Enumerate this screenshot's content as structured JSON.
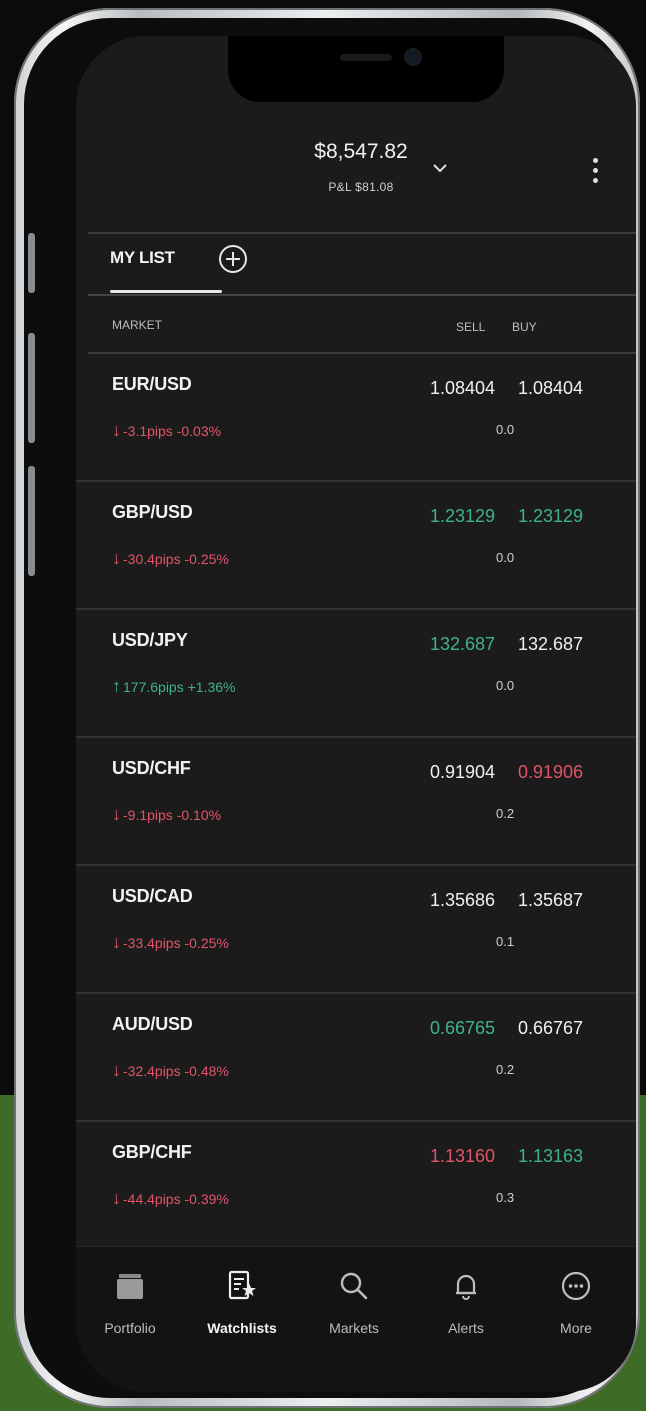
{
  "header": {
    "balance": "$8,547.82",
    "pnl": "P&L $81.08"
  },
  "tabs": {
    "active": "MY LIST"
  },
  "columns": {
    "market": "MARKET",
    "sell": "SELL",
    "buy": "BUY"
  },
  "rows": [
    {
      "pair": "EUR/USD",
      "direction": "down",
      "change": "-3.1pips -0.03%",
      "sell": "1.08404",
      "sell_color": "white",
      "buy": "1.08404",
      "buy_color": "white",
      "spread": "0.0"
    },
    {
      "pair": "GBP/USD",
      "direction": "down",
      "change": "-30.4pips -0.25%",
      "sell": "1.23129",
      "sell_color": "green",
      "buy": "1.23129",
      "buy_color": "green",
      "spread": "0.0"
    },
    {
      "pair": "USD/JPY",
      "direction": "up",
      "change": "177.6pips +1.36%",
      "sell": "132.687",
      "sell_color": "green",
      "buy": "132.687",
      "buy_color": "white",
      "spread": "0.0"
    },
    {
      "pair": "USD/CHF",
      "direction": "down",
      "change": "-9.1pips -0.10%",
      "sell": "0.91904",
      "sell_color": "white",
      "buy": "0.91906",
      "buy_color": "red",
      "spread": "0.2"
    },
    {
      "pair": "USD/CAD",
      "direction": "down",
      "change": "-33.4pips -0.25%",
      "sell": "1.35686",
      "sell_color": "white",
      "buy": "1.35687",
      "buy_color": "white",
      "spread": "0.1"
    },
    {
      "pair": "AUD/USD",
      "direction": "down",
      "change": "-32.4pips -0.48%",
      "sell": "0.66765",
      "sell_color": "green",
      "buy": "0.66767",
      "buy_color": "white",
      "spread": "0.2"
    },
    {
      "pair": "GBP/CHF",
      "direction": "down",
      "change": "-44.4pips -0.39%",
      "sell": "1.13160",
      "sell_color": "red",
      "buy": "1.13163",
      "buy_color": "green",
      "spread": "0.3"
    }
  ],
  "nav": [
    {
      "label": "Portfolio",
      "icon": "portfolio-icon"
    },
    {
      "label": "Watchlists",
      "icon": "watchlist-star-icon",
      "active": true
    },
    {
      "label": "Markets",
      "icon": "search-icon"
    },
    {
      "label": "Alerts",
      "icon": "bell-icon"
    },
    {
      "label": "More",
      "icon": "more-icon"
    }
  ],
  "colors": {
    "green_band": "#3e6b25",
    "screen_bg": "#1b1b1c",
    "price_red": "#e0556a",
    "price_green": "#3fb28a"
  }
}
